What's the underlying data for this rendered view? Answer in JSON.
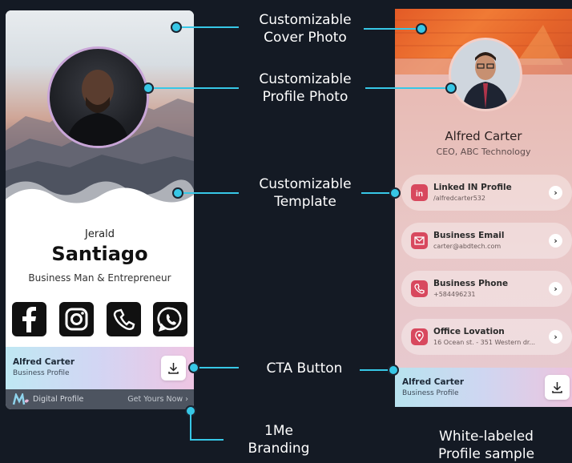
{
  "annotations": {
    "cover_photo": [
      "Customizable",
      "Cover Photo"
    ],
    "profile_photo": [
      "Customizable",
      "Profile Photo"
    ],
    "template": [
      "Customizable",
      "Template"
    ],
    "cta": "CTA Button",
    "branding": [
      "1Me",
      "Branding"
    ],
    "sample": [
      "White-labeled",
      "Profile sample"
    ]
  },
  "left_card": {
    "first_name": "Jerald",
    "last_name": "Santiago",
    "subtitle": "Business Man & Entrepreneur",
    "social_icons": [
      "facebook-icon",
      "instagram-icon",
      "phone-icon",
      "whatsapp-icon"
    ],
    "cta": {
      "name": "Alfred Carter",
      "sub": "Business Profile"
    },
    "branding": {
      "label": "Digital Profile",
      "link": "Get Yours Now ›"
    }
  },
  "right_card": {
    "name": "Alfred Carter",
    "title": "CEO, ABC Technology",
    "links": [
      {
        "icon": "linkedin-icon",
        "title": "Linked IN Profile",
        "sub": "/alfredcarter532"
      },
      {
        "icon": "email-icon",
        "title": "Business Email",
        "sub": "carter@abdtech.com"
      },
      {
        "icon": "phone-icon",
        "title": "Business Phone",
        "sub": "+584496231"
      },
      {
        "icon": "location-icon",
        "title": "Office Lovation",
        "sub": "16 Ocean st. - 351 Western dr..."
      }
    ],
    "cta": {
      "name": "Alfred Carter",
      "sub": "Business Profile"
    }
  },
  "colors": {
    "background": "#141a24",
    "accent": "#37c7e6"
  }
}
